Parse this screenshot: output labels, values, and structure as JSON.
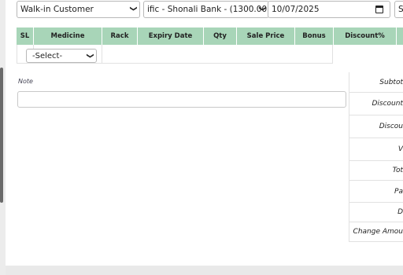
{
  "form": {
    "customer": "Walk-in Customer",
    "payment_account": "ific - Shonali Bank - (1300.00)",
    "date": "10/07/2025",
    "search_partial": "S"
  },
  "table": {
    "headers": [
      "SL",
      "Medicine",
      "Rack",
      "Expiry Date",
      "Qty",
      "Sale Price",
      "Bonus",
      "Discount%"
    ],
    "medicine_select": "-Select-"
  },
  "note": {
    "label": "Note",
    "value": ""
  },
  "summary": {
    "labels": [
      "Subtot",
      "Discount",
      "Discou",
      "V",
      "Tot",
      "Pa",
      "D",
      "Change Amou"
    ]
  },
  "icons": {
    "dropdown": "chevron-down-icon",
    "calendar": "calendar-icon"
  }
}
